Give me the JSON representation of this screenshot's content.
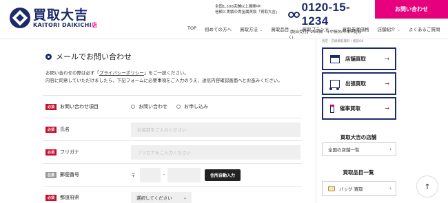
{
  "brand": {
    "logo_jp": "買取大吉",
    "logo_en": "KAITORI DAIKICHI",
    "logo_suffix": "店"
  },
  "header": {
    "tagline_line1": "全国1,300店舗以上展開中!",
    "tagline_line2": "信頼と実績の貴金属買取「買取大吉」",
    "phone": "0120-15-1234",
    "phone_hours": "【総合受付】24時間・年中無休(年末年始除く)",
    "contact_button": "お問い合わせ",
    "nav": [
      "TOP",
      "初めての方へ",
      "買取方法",
      "買取品目",
      "買取ブランド",
      "買取参考価格",
      "店舗紹介",
      "よくあるご質問"
    ]
  },
  "page": {
    "title": "メールでお問い合わせ",
    "intro_prefix": "お問い合わせの際は必ず「",
    "intro_link": "プライバシーポリシー",
    "intro_suffix": "」をご一読ください。",
    "intro_line2": "内容に同意していただけましたら、下記フォームに必要事項をご入力のうえ、送信内容確認画面へとお進みください。"
  },
  "form": {
    "required_badge": "必須",
    "optional_badge": "任意",
    "fields": {
      "inquiry_type": {
        "label": "お問い合わせ項目",
        "options": [
          "お問い合わせ",
          "お申し込み"
        ]
      },
      "name": {
        "label": "氏名",
        "placeholder": "お名前をご入力ください"
      },
      "furigana": {
        "label": "フリガナ",
        "placeholder": "フリガナをご入力ください"
      },
      "postal": {
        "label": "郵便番号",
        "mark": "〒",
        "dash": "-",
        "button": "住所自動入力"
      },
      "prefecture": {
        "label": "都道府県",
        "value": "選択してください"
      }
    }
  },
  "sidebar": {
    "note": "査定・店頭買取無料 / 相談OK",
    "services": [
      "店舗買取",
      "出張買取",
      "催事買取"
    ],
    "stores_heading": "買取大吉の店舗",
    "stores_link": "全国の店舗一覧",
    "items_heading": "買取品目一覧",
    "items": [
      "バッグ 買取"
    ]
  },
  "icons": {
    "arrow": "→",
    "chevron": "›",
    "up": "↑"
  },
  "colors": {
    "navy": "#1b2a6b",
    "accent": "#e6007e",
    "required": "#c8102e"
  }
}
